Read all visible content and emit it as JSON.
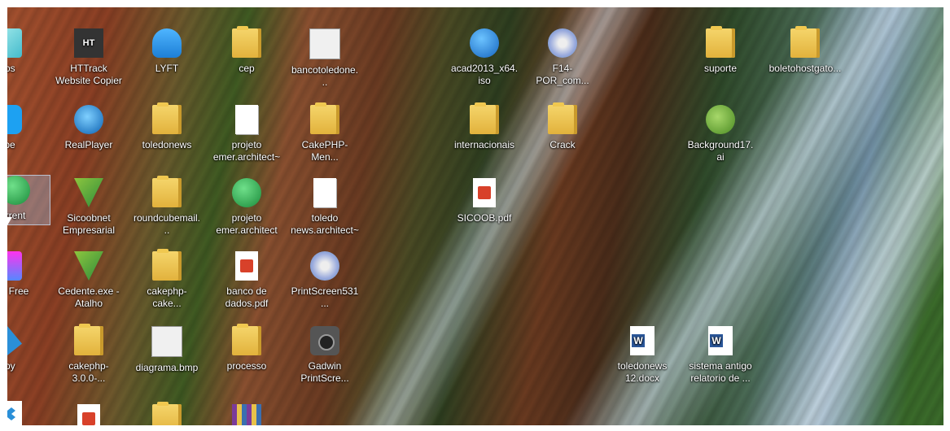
{
  "desktop": {
    "icons": [
      {
        "label": "gos",
        "icon": "partial-app-icon"
      },
      {
        "label": "HTTrack Website Copier",
        "icon": "httrack-icon"
      },
      {
        "label": "LYFT",
        "icon": "lyft-icon"
      },
      {
        "label": "cep",
        "icon": "folder-icon"
      },
      {
        "label": "bancotoledone...",
        "icon": "image-file-icon"
      },
      {
        "label": "acad2013_x64.iso",
        "icon": "iso-file-icon"
      },
      {
        "label": "F14-POR_com...",
        "icon": "installer-icon"
      },
      {
        "label": "suporte",
        "icon": "folder-icon"
      },
      {
        "label": "boletohostgato...",
        "icon": "folder-icon"
      },
      {
        "label": "ype",
        "icon": "skype-icon"
      },
      {
        "label": "RealPlayer",
        "icon": "realplayer-icon"
      },
      {
        "label": "toledonews",
        "icon": "folder-icon"
      },
      {
        "label": "projeto emer.architect~",
        "icon": "blank-file-icon"
      },
      {
        "label": "CakePHP-Men...",
        "icon": "folder-icon"
      },
      {
        "label": "internacionais",
        "icon": "folder-icon"
      },
      {
        "label": "Crack",
        "icon": "folder-icon"
      },
      {
        "label": "Background17.ai",
        "icon": "coreldraw-icon"
      },
      {
        "label": "rrent",
        "icon": "utorrent-icon"
      },
      {
        "label": "Sicoobnet Empresarial",
        "icon": "sicoob-icon"
      },
      {
        "label": "roundcubemail...",
        "icon": "folder-icon"
      },
      {
        "label": "projeto emer.architect",
        "icon": "architect-icon"
      },
      {
        "label": "toledo news.architect~",
        "icon": "blank-file-icon"
      },
      {
        "label": "SICOOB.pdf",
        "icon": "pdf-icon"
      },
      {
        "label": "tPIM Free",
        "icon": "app-icon"
      },
      {
        "label": "Cedente.exe - Atalho",
        "icon": "sicoob-icon"
      },
      {
        "label": "cakephp-cake...",
        "icon": "folder-icon"
      },
      {
        "label": "banco de dados.pdf",
        "icon": "pdf-icon"
      },
      {
        "label": "PrintScreen531...",
        "icon": "printscreen-icon"
      },
      {
        "label": "opy",
        "icon": "app-icon"
      },
      {
        "label": "cakephp-3.0.0-...",
        "icon": "folder-icon"
      },
      {
        "label": "diagrama.bmp",
        "icon": "bmp-file-icon"
      },
      {
        "label": "processo",
        "icon": "folder-icon"
      },
      {
        "label": "Gadwin PrintScre...",
        "icon": "camera-icon"
      },
      {
        "label": "toledonews 12.docx",
        "icon": "word-doc-icon"
      },
      {
        "label": "sistema antigo relatorio de ...",
        "icon": "word-doc-icon"
      }
    ]
  }
}
